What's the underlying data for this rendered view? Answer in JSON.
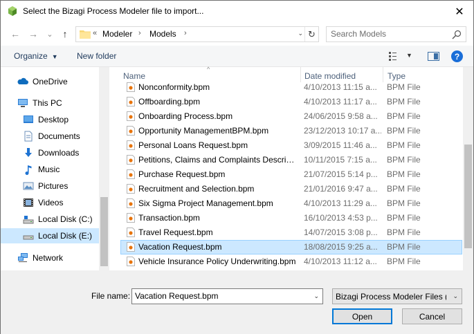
{
  "window": {
    "title": "Select the Bizagi Process Modeler file to import...",
    "close_glyph": "✕"
  },
  "nav": {
    "back_glyph": "←",
    "forward_glyph": "→",
    "recent_glyph": "⌄",
    "up_glyph": "↑"
  },
  "address": {
    "overflow": "«",
    "parts": [
      "Modeler",
      "Models"
    ],
    "separator": "›",
    "dropdown_glyph": "⌄",
    "refresh_glyph": "↻"
  },
  "search": {
    "placeholder": "Search Models"
  },
  "toolbar": {
    "organize_label": "Organize",
    "caret": "▼",
    "new_folder_label": "New folder",
    "help_glyph": "?"
  },
  "sidebar": {
    "items": [
      {
        "label": "OneDrive",
        "icon": "onedrive-icon"
      },
      {
        "label": "This PC",
        "icon": "this-pc-icon"
      },
      {
        "label": "Desktop",
        "icon": "desktop-icon"
      },
      {
        "label": "Documents",
        "icon": "documents-icon"
      },
      {
        "label": "Downloads",
        "icon": "downloads-icon"
      },
      {
        "label": "Music",
        "icon": "music-icon"
      },
      {
        "label": "Pictures",
        "icon": "pictures-icon"
      },
      {
        "label": "Videos",
        "icon": "videos-icon"
      },
      {
        "label": "Local Disk (C:)",
        "icon": "drive-icon"
      },
      {
        "label": "Local Disk (E:)",
        "icon": "drive-icon",
        "selected": true
      },
      {
        "label": "Network",
        "icon": "network-icon"
      }
    ]
  },
  "columns": {
    "name": "Name",
    "date": "Date modified",
    "type": "Type",
    "sort_glyph": "^"
  },
  "files": [
    {
      "name": "Nonconformity.bpm",
      "date": "4/10/2013 11:15 a...",
      "type": "BPM File"
    },
    {
      "name": "Offboarding.bpm",
      "date": "4/10/2013 11:17 a...",
      "type": "BPM File"
    },
    {
      "name": "Onboarding Process.bpm",
      "date": "24/06/2015 9:58 a...",
      "type": "BPM File"
    },
    {
      "name": "Opportunity ManagementBPM.bpm",
      "date": "23/12/2013 10:17 a...",
      "type": "BPM File"
    },
    {
      "name": "Personal Loans Request.bpm",
      "date": "3/09/2015 11:46 a...",
      "type": "BPM File"
    },
    {
      "name": "Petitions, Claims and Complaints Descrip...",
      "date": "10/11/2015 7:15 a...",
      "type": "BPM File"
    },
    {
      "name": "Purchase Request.bpm",
      "date": "21/07/2015 5:14 p...",
      "type": "BPM File"
    },
    {
      "name": "Recruitment and Selection.bpm",
      "date": "21/01/2016 9:47 a...",
      "type": "BPM File"
    },
    {
      "name": "Six Sigma Project Management.bpm",
      "date": "4/10/2013 11:29 a...",
      "type": "BPM File"
    },
    {
      "name": "Transaction.bpm",
      "date": "16/10/2013 4:53 p...",
      "type": "BPM File"
    },
    {
      "name": "Travel Request.bpm",
      "date": "14/07/2015 3:08 p...",
      "type": "BPM File"
    },
    {
      "name": "Vacation Request.bpm",
      "date": "18/08/2015 9:25 a...",
      "type": "BPM File",
      "selected": true
    },
    {
      "name": "Vehicle Insurance Policy Underwriting.bpm",
      "date": "4/10/2013 11:12 a...",
      "type": "BPM File"
    }
  ],
  "footer": {
    "filename_label": "File name:",
    "filename_value": "Vacation Request.bpm",
    "dropdown_glyph": "⌄",
    "filetype_label": "Bizagi Process Modeler Files (*.bpm)",
    "open_label": "Open",
    "cancel_label": "Cancel"
  },
  "colors": {
    "selection": "#cce8ff",
    "accent": "#0078d7",
    "bpm_icon": "#e8740c"
  }
}
